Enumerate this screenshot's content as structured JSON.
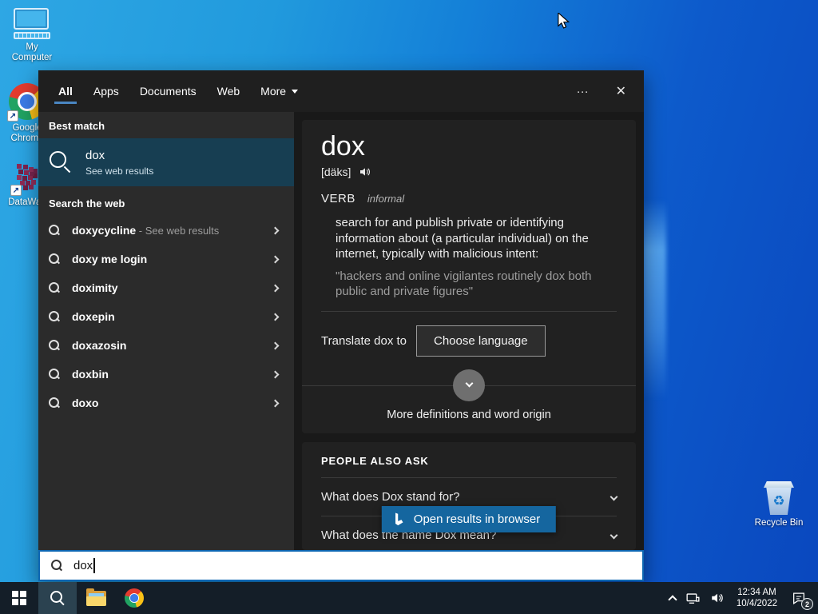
{
  "desktop": {
    "icons": [
      {
        "label": "My Computer"
      },
      {
        "label": "Google Chrome"
      },
      {
        "label": "DataWag"
      },
      {
        "label": "Recycle Bin"
      }
    ],
    "recycle_glyph": "♻",
    "shortcut_glyph": "↗"
  },
  "search_panel": {
    "tabs": [
      {
        "label": "All"
      },
      {
        "label": "Apps"
      },
      {
        "label": "Documents"
      },
      {
        "label": "Web"
      },
      {
        "label": "More"
      }
    ],
    "header_icons": {
      "ellipsis": "···",
      "close": "✕"
    },
    "best_match": {
      "header": "Best match",
      "title": "dox",
      "subtitle": "See web results"
    },
    "web_suggestions": {
      "header": "Search the web",
      "items": [
        {
          "query": "doxycycline",
          "suffix": " - See web results"
        },
        {
          "query": "doxy me login"
        },
        {
          "query": "doximity"
        },
        {
          "query": "doxepin"
        },
        {
          "query": "doxazosin"
        },
        {
          "query": "doxbin"
        },
        {
          "query": "doxo"
        }
      ]
    },
    "definition": {
      "word": "dox",
      "pronunciation": "[däks]",
      "part_of_speech": "VERB",
      "register": "informal",
      "definition": "search for and publish private or identifying information about (a particular individual) on the internet, typically with malicious intent:",
      "example": "\"hackers and online vigilantes routinely dox both public and private figures\""
    },
    "translate": {
      "label": "Translate dox to",
      "button_label": "Choose language"
    },
    "more_link": "More definitions and word origin",
    "people_also_ask": {
      "header": "PEOPLE ALSO ASK",
      "questions": [
        {
          "text": "What does Dox stand for?"
        },
        {
          "text": "What does the name Dox mean?"
        }
      ]
    },
    "open_results_label": "Open results in browser",
    "search_box": {
      "value": "dox"
    }
  },
  "taskbar": {
    "clock": {
      "time": "12:34 AM",
      "date": "10/4/2022"
    },
    "notification_count": "2"
  },
  "colors": {
    "accent": "#0d66b2",
    "highlight": "#173e52",
    "open_button": "#15669f",
    "desktop_left": "#2ea7e4",
    "desktop_right": "#0a47be"
  }
}
